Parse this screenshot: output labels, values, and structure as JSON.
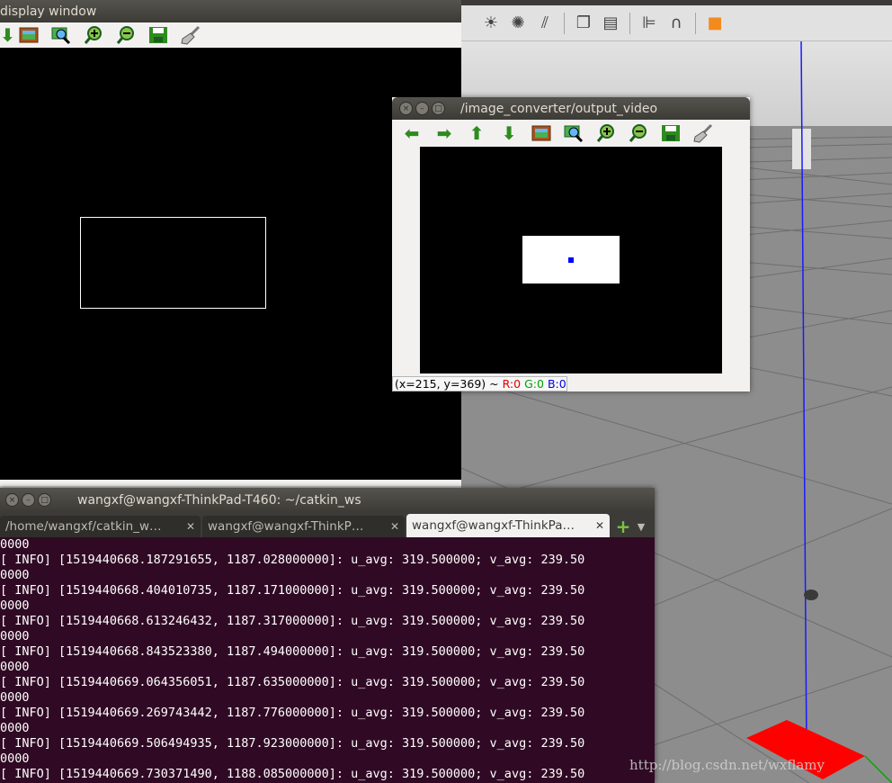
{
  "display_window": {
    "title": "display window",
    "toolbar_icons": [
      "arrow-down-icon",
      "image-icon",
      "zoom-fit-icon",
      "zoom-in-icon",
      "zoom-out-icon",
      "save-icon",
      "broom-icon"
    ]
  },
  "output_window": {
    "title": "/image_converter/output_video",
    "toolbar_icons": [
      "arrow-left-icon",
      "arrow-right-icon",
      "arrow-up-icon",
      "arrow-down-icon",
      "image-icon",
      "zoom-fit-icon",
      "zoom-in-icon",
      "zoom-out-icon",
      "save-icon",
      "broom-icon"
    ],
    "status": {
      "coords": "(x=215, y=369) ~",
      "r": "R:0",
      "g": "G:0",
      "b": "B:0"
    }
  },
  "terminal": {
    "title": "wangxf@wangxf-ThinkPad-T460: ~/catkin_ws",
    "tabs": [
      {
        "label": "/home/wangxf/catkin_w…",
        "active": false
      },
      {
        "label": "wangxf@wangxf-ThinkP…",
        "active": false
      },
      {
        "label": "wangxf@wangxf-ThinkPa…",
        "active": true
      }
    ],
    "lines": [
      "0000",
      "[ INFO] [1519440668.187291655, 1187.028000000]: u_avg: 319.500000; v_avg: 239.50",
      "0000",
      "[ INFO] [1519440668.404010735, 1187.171000000]: u_avg: 319.500000; v_avg: 239.50",
      "0000",
      "[ INFO] [1519440668.613246432, 1187.317000000]: u_avg: 319.500000; v_avg: 239.50",
      "0000",
      "[ INFO] [1519440668.843523380, 1187.494000000]: u_avg: 319.500000; v_avg: 239.50",
      "0000",
      "[ INFO] [1519440669.064356051, 1187.635000000]: u_avg: 319.500000; v_avg: 239.50",
      "0000",
      "[ INFO] [1519440669.269743442, 1187.776000000]: u_avg: 319.500000; v_avg: 239.50",
      "0000",
      "[ INFO] [1519440669.506494935, 1187.923000000]: u_avg: 319.500000; v_avg: 239.50",
      "0000",
      "[ INFO] [1519440669.730371490, 1188.085000000]: u_avg: 319.500000; v_avg: 239.50"
    ]
  },
  "gazebo_toolbar_icons": [
    "sun-icon",
    "point-light-icon",
    "directional-light-icon",
    "copy-icon",
    "paste-icon",
    "align-icon",
    "magnet-icon",
    "box-color-icon"
  ],
  "watermark": "http://blog.csdn.net/wxflamy",
  "colors": {
    "terminal_bg": "#300a24",
    "titlebar": "#3c3b37",
    "toolbar_icon_green": "#2e8b1e",
    "ground_marker": "#ff0000",
    "z_axis": "#1a1aff"
  }
}
